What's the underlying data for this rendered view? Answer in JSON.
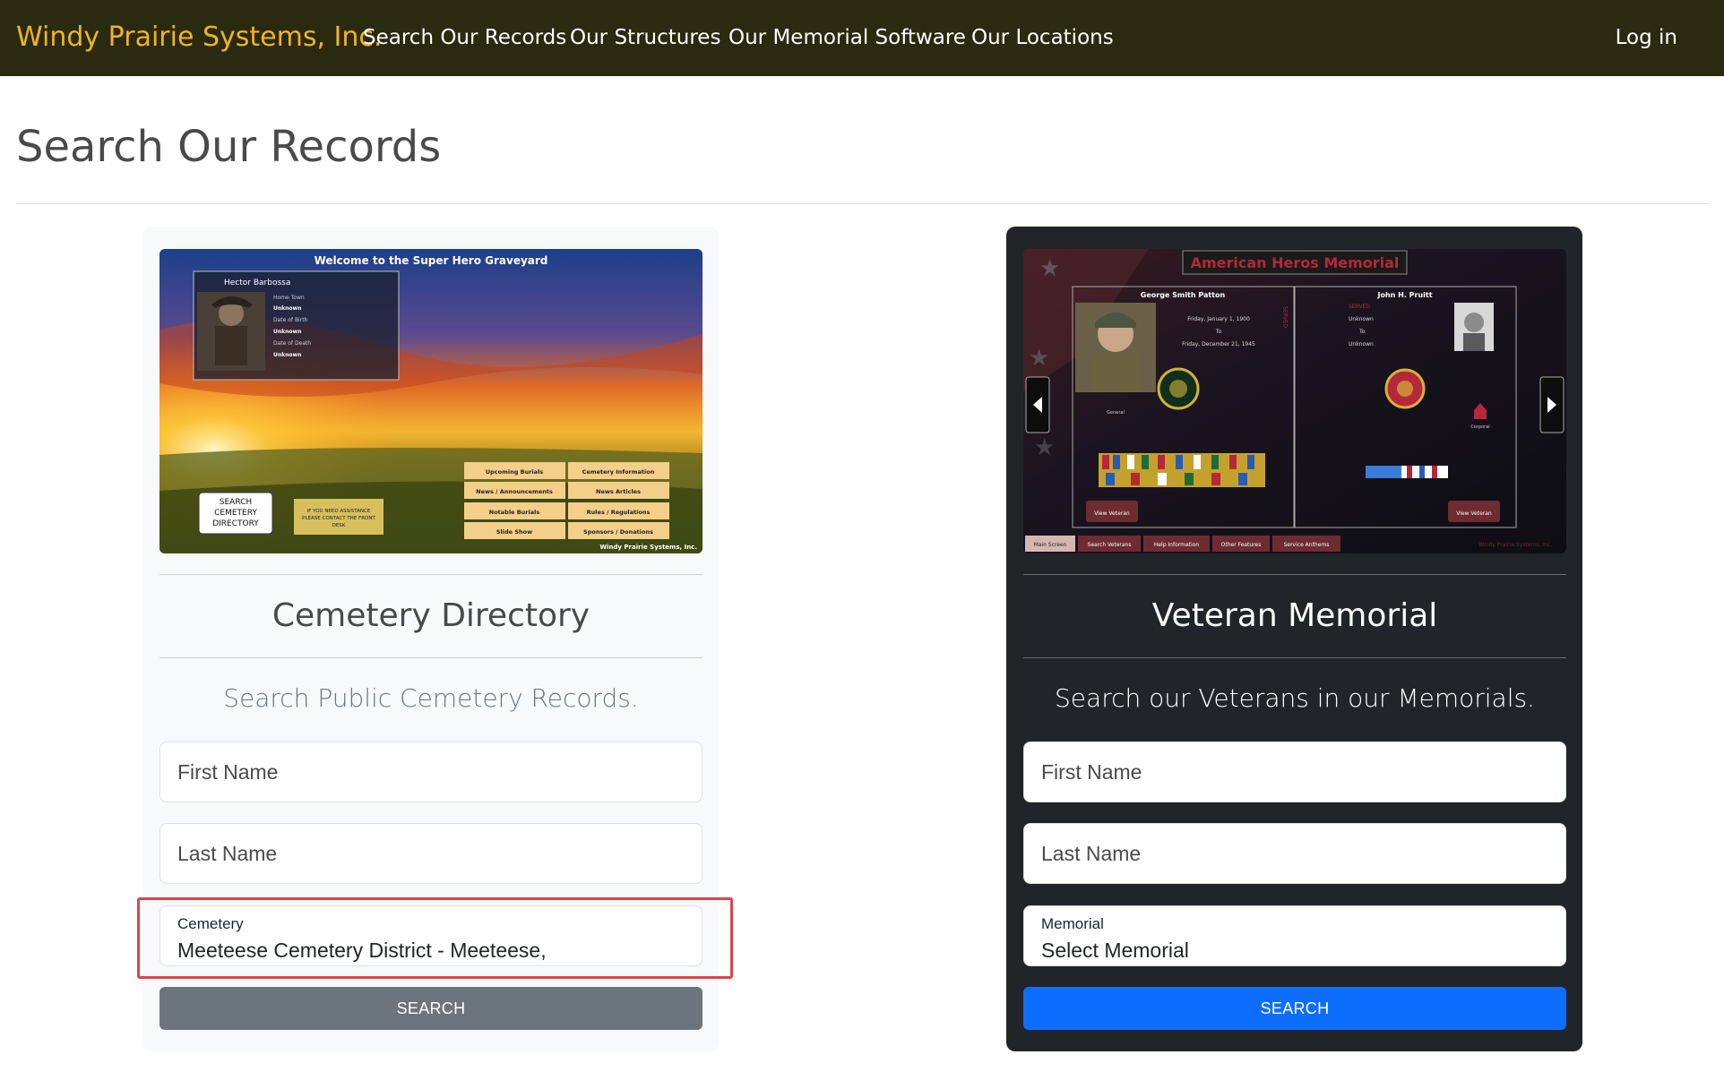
{
  "navbar": {
    "brand": "Windy Prairie Systems, Inc.",
    "links": [
      "Search Our Records",
      "Our Structures",
      "Our Memorial Software",
      "Our Locations"
    ],
    "login": "Log in"
  },
  "page": {
    "title": "Search Our Records"
  },
  "cemetery_card": {
    "title": "Cemetery Directory",
    "subtitle": "Search Public Cemetery Records.",
    "first_name_placeholder": "First Name",
    "last_name_placeholder": "Last Name",
    "cemetery_label": "Cemetery",
    "cemetery_value": "Meeteese Cemetery District - Meeteese,",
    "search_label": "SEARCH",
    "image": {
      "header": "Welcome to the Super Hero Graveyard",
      "person_name": "Hector Barbossa",
      "info_rows": [
        "Home Town",
        "Unknown",
        "Date of Birth",
        "Unknown",
        "Date of Death",
        "Unknown"
      ],
      "search_button": [
        "SEARCH",
        "CEMETERY",
        "DIRECTORY"
      ],
      "assist_note": [
        "IF YOU NEED ASSISTANCE",
        "PLEASE CONTACT THE FRONT",
        "DESK"
      ],
      "menu": [
        "Upcoming Burials",
        "Cemetery Information",
        "News / Announcements",
        "News Articles",
        "Notable Burials",
        "Rules / Regulations",
        "Slide Show",
        "Sponsors / Donations"
      ],
      "footer": "Windy Prairie Systems, Inc."
    }
  },
  "memorial_card": {
    "title": "Veteran Memorial",
    "subtitle": "Search our Veterans in our Memorials.",
    "first_name_placeholder": "First Name",
    "last_name_placeholder": "Last Name",
    "memorial_label": "Memorial",
    "memorial_value": "Select Memorial",
    "search_label": "SEARCH",
    "image": {
      "header": "American Heros Memorial",
      "left_name": "George Smith Patton",
      "left_dates": [
        "Friday, January 1, 1900",
        "To",
        "Friday, December 21, 1945"
      ],
      "served": "SERVED",
      "left_rank": "General",
      "right_name": "John H. Pruitt",
      "right_dates": [
        "SERVED",
        "Unknown",
        "To",
        "Unknown"
      ],
      "right_rank": "Corporal",
      "view_button": "View Veteran",
      "tabs": [
        "Main Screen",
        "Search Veterans",
        "Help Information",
        "Other Features",
        "Service Anthems"
      ],
      "footer": "Windy Prairie Systems, Inc."
    }
  },
  "colors": {
    "navbar": "#2a2a11",
    "brand": "#f0b324",
    "primary": "#0d6efd",
    "secondary": "#6c757d",
    "dark_card": "#212529",
    "highlight": "#e0414a"
  }
}
